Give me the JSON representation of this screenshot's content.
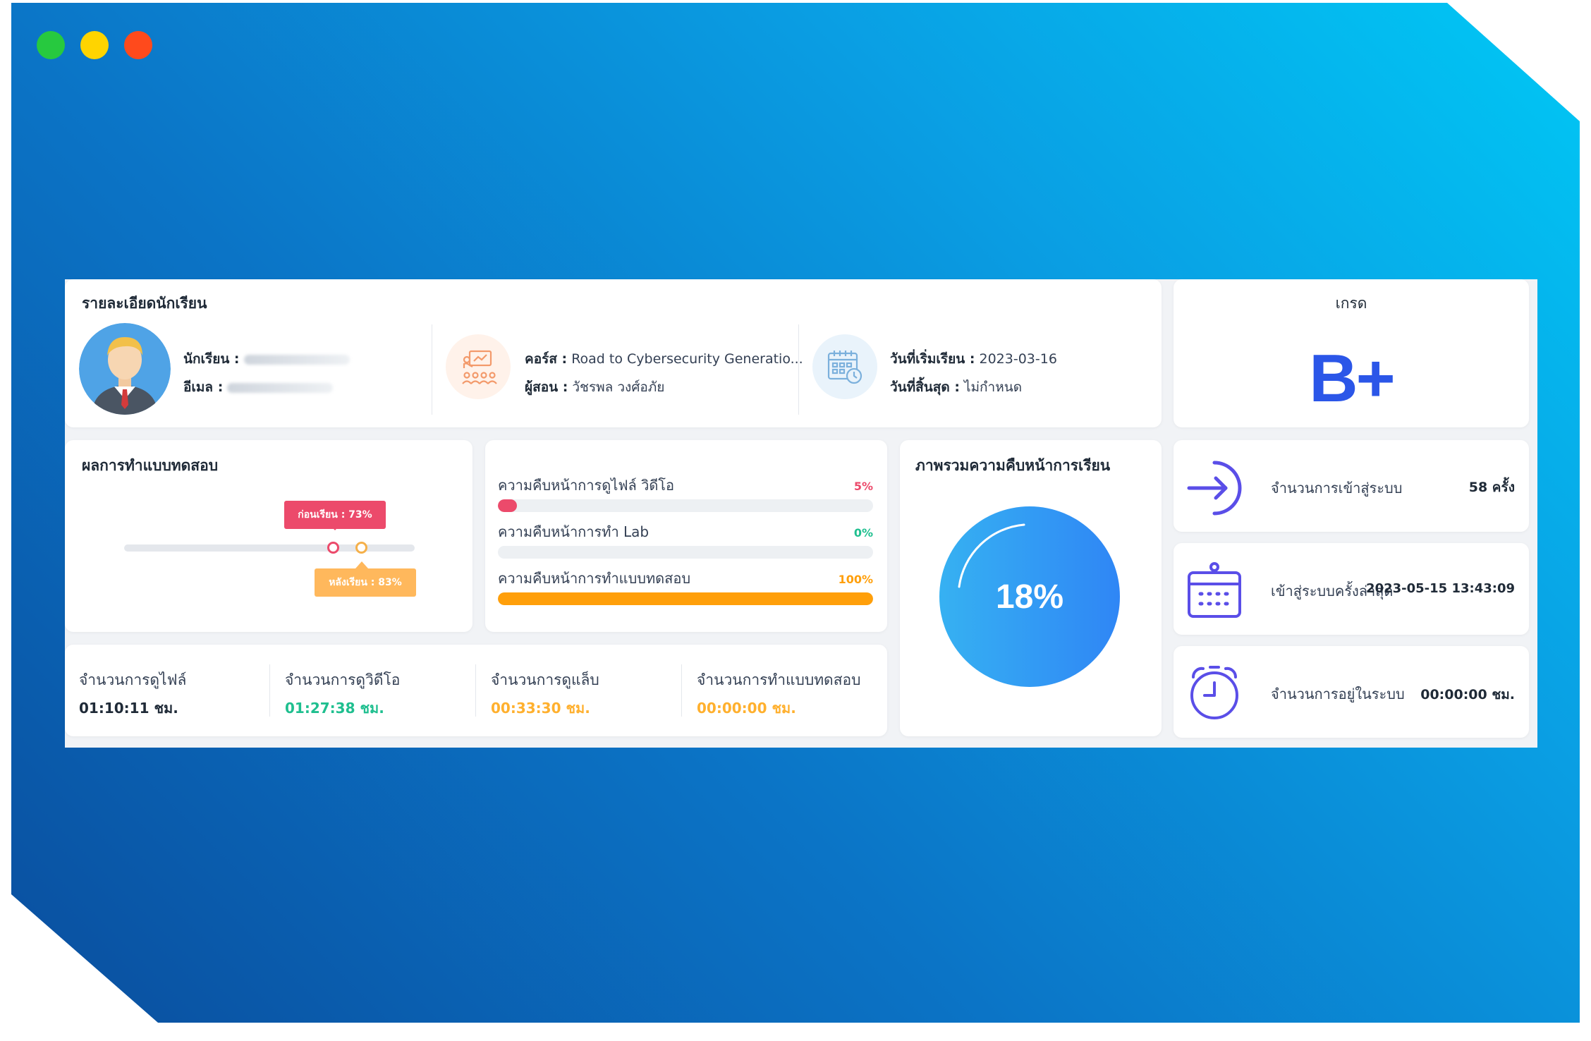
{
  "student_card": {
    "title": "รายละเอียดนักเรียน",
    "student_label": "นักเรียน :",
    "email_label": "อีเมล :",
    "course_label": "คอร์ส :",
    "course_value": "Road to Cybersecurity Generatio...",
    "instructor_label": "ผู้สอน :",
    "instructor_value": "วัชรพล วงศ์อภัย",
    "start_label": "วันที่เริ่มเรียน :",
    "start_value": "2023-03-16",
    "end_label": "วันที่สิ้นสุด :",
    "end_value": "ไม่กำหนด"
  },
  "grade_card": {
    "title": "เกรด",
    "value": "B+"
  },
  "test_result": {
    "title": "ผลการทำแบบทดสอบ",
    "before_label": "ก่อนเรียน : 73%",
    "after_label": "หลังเรียน : 83%",
    "before_pct": 73,
    "after_pct": 83
  },
  "progress": {
    "items": [
      {
        "label": "ความคืบหน้าการดูไฟล์ วิดีโอ",
        "pct_label": "5%",
        "pct": 5,
        "color": "#ec4a6b"
      },
      {
        "label": "ความคืบหน้าการทำ Lab",
        "pct_label": "0%",
        "pct": 0,
        "color": "#1fbf8f"
      },
      {
        "label": "ความคืบหน้าการทำแบบทดสอบ",
        "pct_label": "100%",
        "pct": 100,
        "color": "#ff9f0a"
      }
    ]
  },
  "overview": {
    "title": "ภาพรวมความคืบหน้าการเรียน",
    "value": "18%"
  },
  "stats": [
    {
      "label": "จำนวนการดูไฟล์",
      "value": "01:10:11 ชม.",
      "color": "#1f2a37"
    },
    {
      "label": "จำนวนการดูวิดีโอ",
      "value": "01:27:38 ชม.",
      "color": "#1fbf8f"
    },
    {
      "label": "จำนวนการดูแล็บ",
      "value": "00:33:30 ชม.",
      "color": "#ffb02e"
    },
    {
      "label": "จำนวนการทำแบบทดสอบ",
      "value": "00:00:00 ชม.",
      "color": "#ffb02e"
    }
  ],
  "right_stats": {
    "logins": {
      "label": "จำนวนการเข้าสู่ระบบ",
      "value": "58 ครั้ง"
    },
    "last_login": {
      "label": "เข้าสู่ระบบครั้งล่าสุด",
      "value": "2023-05-15 13:43:09"
    },
    "time_in_system": {
      "label": "จำนวนการอยู่ในระบบ",
      "value": "00:00:00 ชม."
    }
  },
  "colors": {
    "accent_blue": "#2b56e8",
    "icon_purple": "#5a4ee8",
    "before_pink": "#ec4a6b",
    "after_orange": "#ffb85c"
  }
}
